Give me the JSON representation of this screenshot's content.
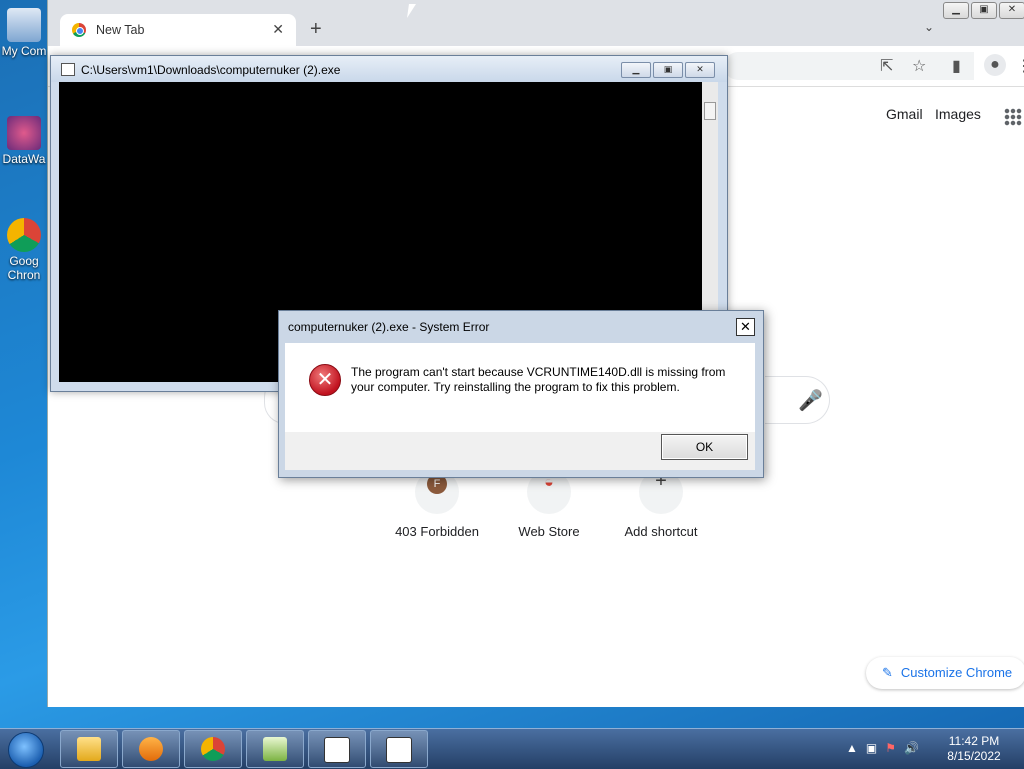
{
  "desktop": {
    "icons": [
      {
        "label": "My Com",
        "name": "computer-icon"
      },
      {
        "label": "DataWa",
        "name": "datawatch-icon"
      },
      {
        "label": "Goog Chron",
        "name": "chrome-desktop-icon"
      }
    ]
  },
  "chrome": {
    "tab_title": "New Tab",
    "tab_close": "✕",
    "new_tab": "+",
    "tab_dropdown": "⌄",
    "links": {
      "gmail": "Gmail",
      "images": "Images"
    },
    "shortcuts": [
      {
        "label": "403 Forbidden",
        "glyph": "F"
      },
      {
        "label": "Web Store",
        "glyph": "◒"
      },
      {
        "label": "Add shortcut",
        "glyph": "+"
      }
    ],
    "customize_label": "Customize Chrome",
    "share_icon": "⇱",
    "bookmark_icon": "☆",
    "sidepanel_icon": "▮",
    "profile_icon": "●",
    "menu_icon": "⋮",
    "mic_icon": "🎤"
  },
  "console": {
    "title": "C:\\Users\\vm1\\Downloads\\computernuker (2).exe"
  },
  "dialog": {
    "title": "computernuker (2).exe - System Error",
    "close": "✕",
    "message": "The program can't start because VCRUNTIME140D.dll is missing from your computer. Try reinstalling the program to fix this problem.",
    "ok_label": "OK",
    "icon": "✕"
  },
  "taskbar": {
    "clock_time": "11:42 PM",
    "clock_date": "8/15/2022",
    "apps": [
      "explorer",
      "media-player",
      "chrome",
      "notepad-plus",
      "console",
      "console"
    ]
  }
}
